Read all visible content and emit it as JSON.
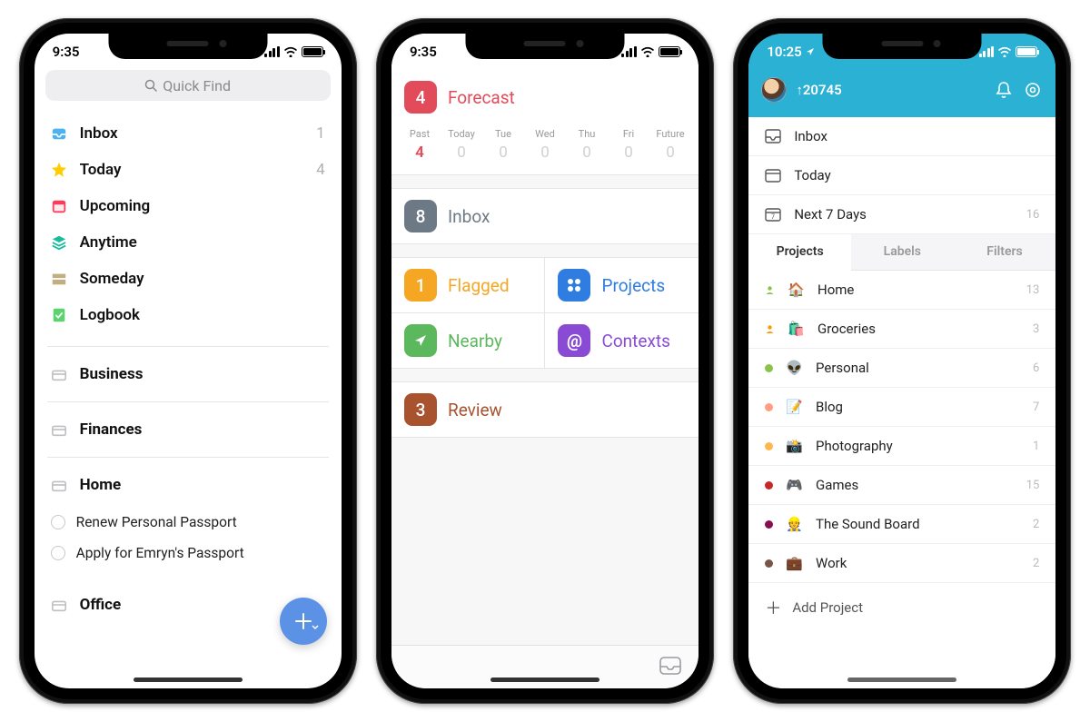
{
  "phone1": {
    "time": "9:35",
    "search_placeholder": "Quick Find",
    "smart_lists": [
      {
        "icon": "inbox",
        "label": "Inbox",
        "count": "1",
        "color": "#3a9de0",
        "bg": "#e9f3fc"
      },
      {
        "icon": "star",
        "label": "Today",
        "count": "4",
        "color": "#ffcc00"
      },
      {
        "icon": "calendar",
        "label": "Upcoming",
        "color": "#ff3b57"
      },
      {
        "icon": "stack",
        "label": "Anytime",
        "color": "#1abc9c"
      },
      {
        "icon": "drawer",
        "label": "Someday",
        "color": "#b9a77f"
      },
      {
        "icon": "logbook",
        "label": "Logbook",
        "color": "#3cc35a"
      }
    ],
    "areas": [
      {
        "label": "Business",
        "tasks": []
      },
      {
        "label": "Finances",
        "tasks": []
      },
      {
        "label": "Home",
        "tasks": [
          "Renew Personal Passport",
          "Apply for Emryn's Passport"
        ]
      },
      {
        "label": "Office",
        "tasks": []
      }
    ]
  },
  "phone2": {
    "time": "9:35",
    "forecast": {
      "badge": "4",
      "label": "Forecast",
      "color": "#e14b5a"
    },
    "forecast_days": [
      {
        "lbl": "Past",
        "val": "4",
        "active": true
      },
      {
        "lbl": "Today",
        "val": "0"
      },
      {
        "lbl": "Tue",
        "val": "0"
      },
      {
        "lbl": "Wed",
        "val": "0"
      },
      {
        "lbl": "Thu",
        "val": "0"
      },
      {
        "lbl": "Fri",
        "val": "0"
      },
      {
        "lbl": "Future",
        "val": "0"
      }
    ],
    "inbox": {
      "badge": "8",
      "label": "Inbox",
      "bg": "#6d7a86"
    },
    "tiles": [
      {
        "badge": "1",
        "label": "Flagged",
        "bg": "#f5a623",
        "text": "#f5a623",
        "type": "count"
      },
      {
        "icon": "grid",
        "label": "Projects",
        "bg": "#2f7de0",
        "text": "#2f7de0"
      },
      {
        "icon": "nav",
        "label": "Nearby",
        "bg": "#5cb85c",
        "text": "#5cb85c"
      },
      {
        "icon": "at",
        "label": "Contexts",
        "bg": "#8a4bd4",
        "text": "#8a4bd4"
      }
    ],
    "review": {
      "badge": "3",
      "label": "Review",
      "bg": "#a0452a",
      "text": "#a9522e"
    }
  },
  "phone3": {
    "time": "10:25",
    "karma": "20745",
    "nav": [
      {
        "icon": "inbox",
        "label": "Inbox"
      },
      {
        "icon": "today",
        "label": "Today"
      },
      {
        "icon": "next7",
        "label": "Next 7 Days",
        "count": "16"
      }
    ],
    "tabs": [
      "Projects",
      "Labels",
      "Filters"
    ],
    "active_tab": "Projects",
    "projects": [
      {
        "dot": "#8bc34a",
        "shared": true,
        "emoji": "🏠",
        "label": "Home",
        "count": "13"
      },
      {
        "dot": "#ff9800",
        "shared": true,
        "emoji": "🛍️",
        "label": "Groceries",
        "count": "3"
      },
      {
        "dot": "#8bc34a",
        "emoji": "👽",
        "label": "Personal",
        "count": "6"
      },
      {
        "dot": "#ff9e80",
        "emoji": "📝",
        "label": "Blog",
        "count": "7"
      },
      {
        "dot": "#ffb74d",
        "emoji": "📸",
        "label": "Photography",
        "count": "1"
      },
      {
        "dot": "#c62828",
        "emoji": "🎮",
        "label": "Games",
        "count": "15"
      },
      {
        "dot": "#880e4f",
        "emoji": "👷",
        "label": "The Sound Board",
        "count": "2"
      },
      {
        "dot": "#795548",
        "emoji": "💼",
        "label": "Work",
        "count": "2"
      }
    ],
    "add_project": "Add Project"
  }
}
